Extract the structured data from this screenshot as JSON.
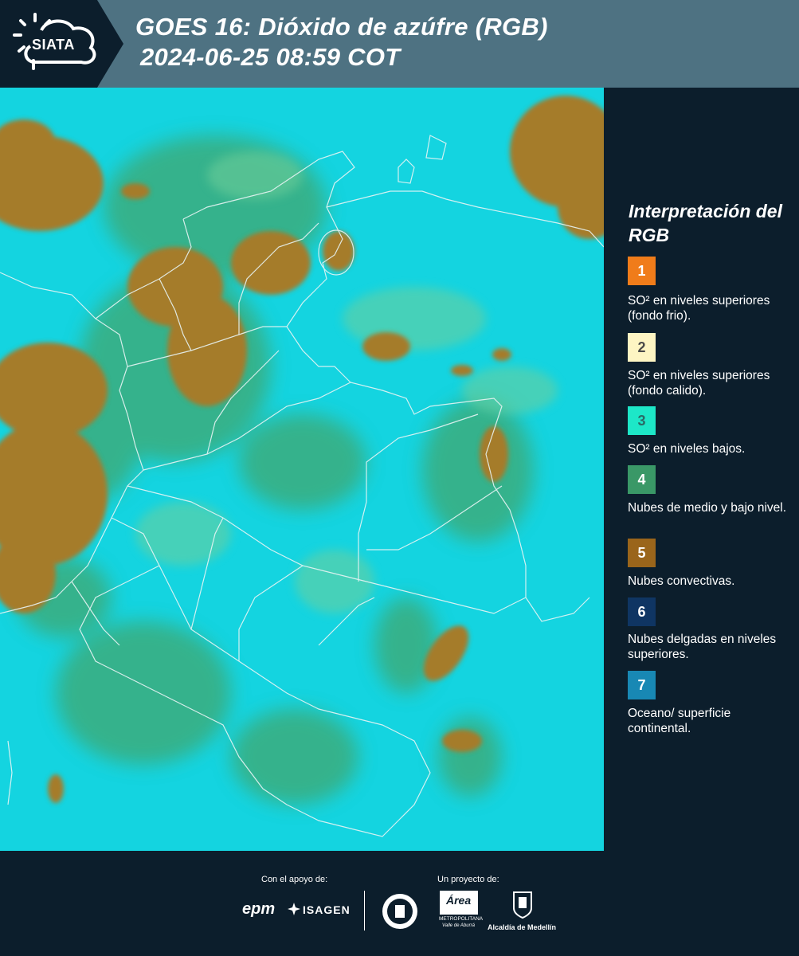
{
  "header": {
    "logo_text": "SIATA",
    "title_line1": "GOES 16: Dióxido de azúfre (RGB)",
    "title_line2": "2024-06-25 08:59 COT"
  },
  "legend": {
    "title": "Interpretación del RGB",
    "items": [
      {
        "number": "1",
        "label": "SO² en niveles superiores (fondo frio).",
        "color": "#f07c1a",
        "text_color": "#ffffff"
      },
      {
        "number": "2",
        "label": "SO² en niveles superiores (fondo calido).",
        "color": "#fdf5c3",
        "text_color": "#4a4a4a"
      },
      {
        "number": "3",
        "label": "SO² en niveles bajos.",
        "color": "#1de7c8",
        "text_color": "#2a6a66"
      },
      {
        "number": "4",
        "label": "Nubes de medio y bajo nivel.",
        "color": "#3a9867",
        "text_color": "#ffffff"
      },
      {
        "number": "5",
        "label": "Nubes convectivas.",
        "color": "#9a651b",
        "text_color": "#ffffff"
      },
      {
        "number": "6",
        "label": "Nubes delgadas en niveles superiores.",
        "color": "#0f3563",
        "text_color": "#ffffff"
      },
      {
        "number": "7",
        "label": "Oceano/ superficie continental.",
        "color": "#1888b4",
        "text_color": "#ffffff"
      }
    ]
  },
  "footer": {
    "support_caption": "Con el apoyo de:",
    "project_caption": "Un proyecto de:",
    "logo_epm": "epm",
    "logo_isagen": "ISAGEN",
    "logo_area_metro": "Área",
    "logo_area_metro_sub": "METROPOLITANA",
    "logo_area_metro_sub2": "Valle de Aburrá",
    "logo_alcaldia": "Alcaldía de Medellín"
  },
  "colors": {
    "background": "#0c1e2c",
    "header_band": "#4e7282",
    "map_cyan": "#12d2de",
    "cloud_brown": "#a07628",
    "cloud_green": "#3a9a5e"
  }
}
